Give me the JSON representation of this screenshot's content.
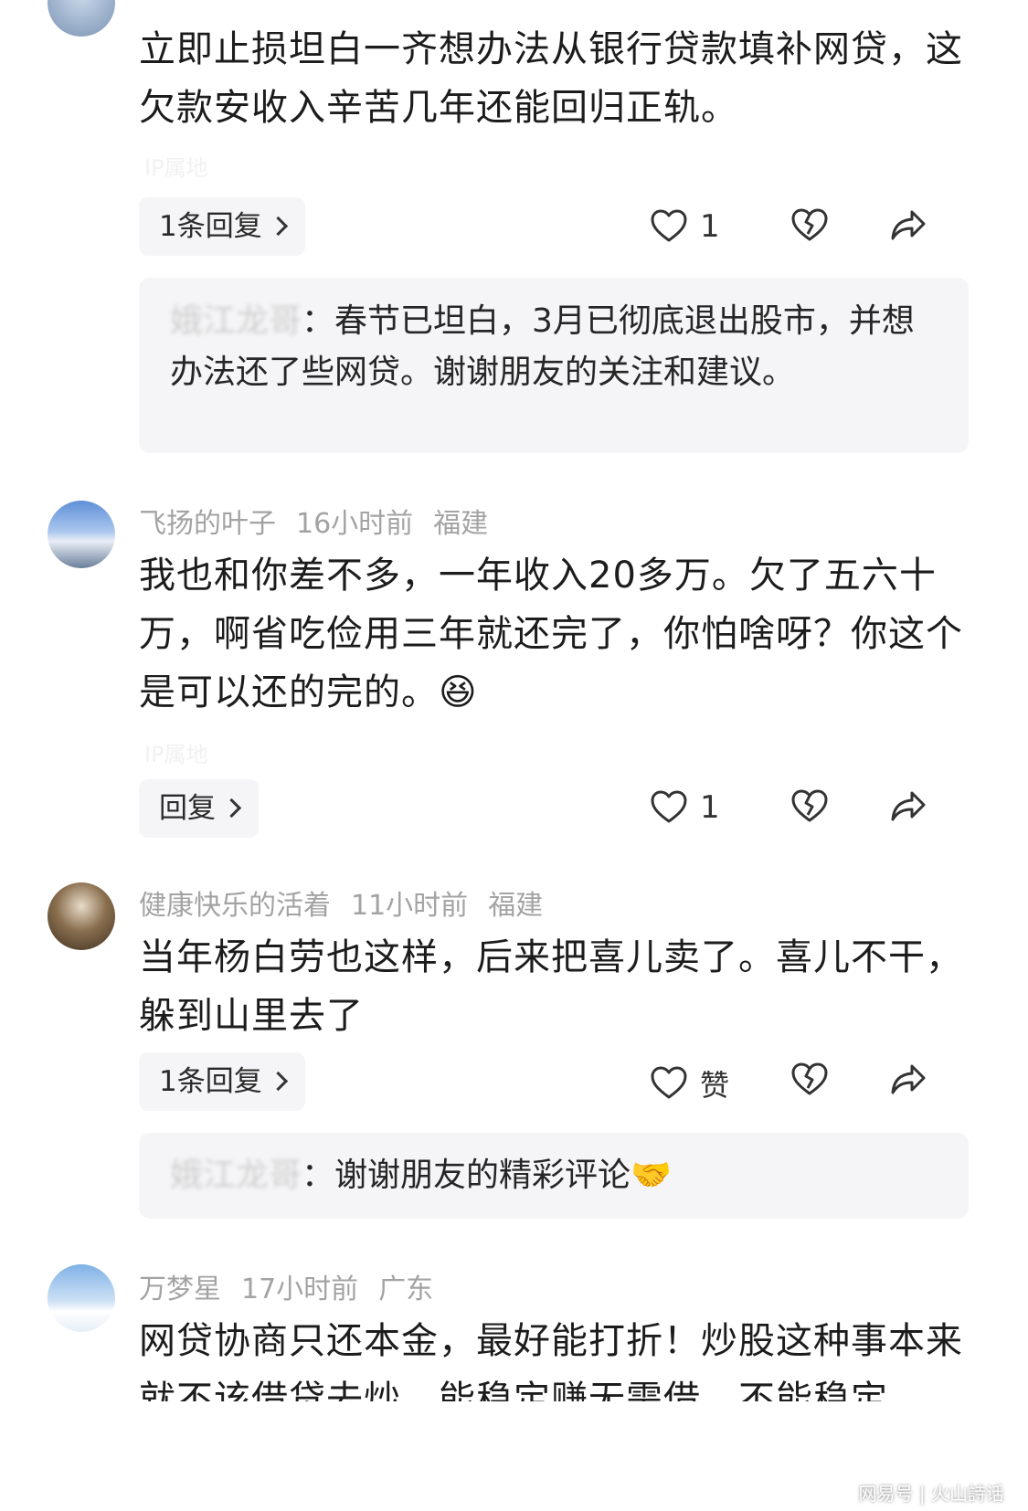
{
  "comments": [
    {
      "text": "立即止损坦白一齐想办法从银行贷款填补网贷，这欠款安收入辛苦几年还能回归正轨。",
      "ip": "IP属地",
      "reply_button": "1条回复",
      "like_count": "1",
      "reply": {
        "author": "娥江龙哥",
        "text": "：春节已坦白，3月已彻底退出股市，并想办法还了些网贷。谢谢朋友的关注和建议。"
      }
    },
    {
      "username": "飞扬的叶子",
      "time": "16小时前",
      "location": "福建",
      "text": "我也和你差不多，一年收入20多万。欠了五六十万，啊省吃俭用三年就还完了，你怕啥呀？你这个是可以还的完的。",
      "emoji": "😆",
      "ip": "IP属地",
      "reply_button": "回复",
      "like_count": "1"
    },
    {
      "username": "健康快乐的活着",
      "time": "11小时前",
      "location": "福建",
      "text": "当年杨白劳也这样，后来把喜儿卖了。喜儿不干，躲到山里去了",
      "reply_button": "1条回复",
      "like_count": "赞",
      "reply": {
        "author": "娥江龙哥",
        "text": "：谢谢朋友的精彩评论",
        "emoji": "🤝"
      }
    },
    {
      "username": "万梦星",
      "time": "17小时前",
      "location": "广东",
      "text": "网贷协商只还本金，最好能打折！炒股这种事本来就不该借贷去炒，能稳定赚无需借，不能稳定"
    }
  ],
  "icons": {
    "like": "heart-icon",
    "dislike": "broken-heart-icon",
    "share": "share-icon"
  },
  "colors": {
    "meta_text": "#a3a3a3",
    "pill_bg": "#f5f5f7"
  },
  "watermark": "网易号 | 火山詩话"
}
